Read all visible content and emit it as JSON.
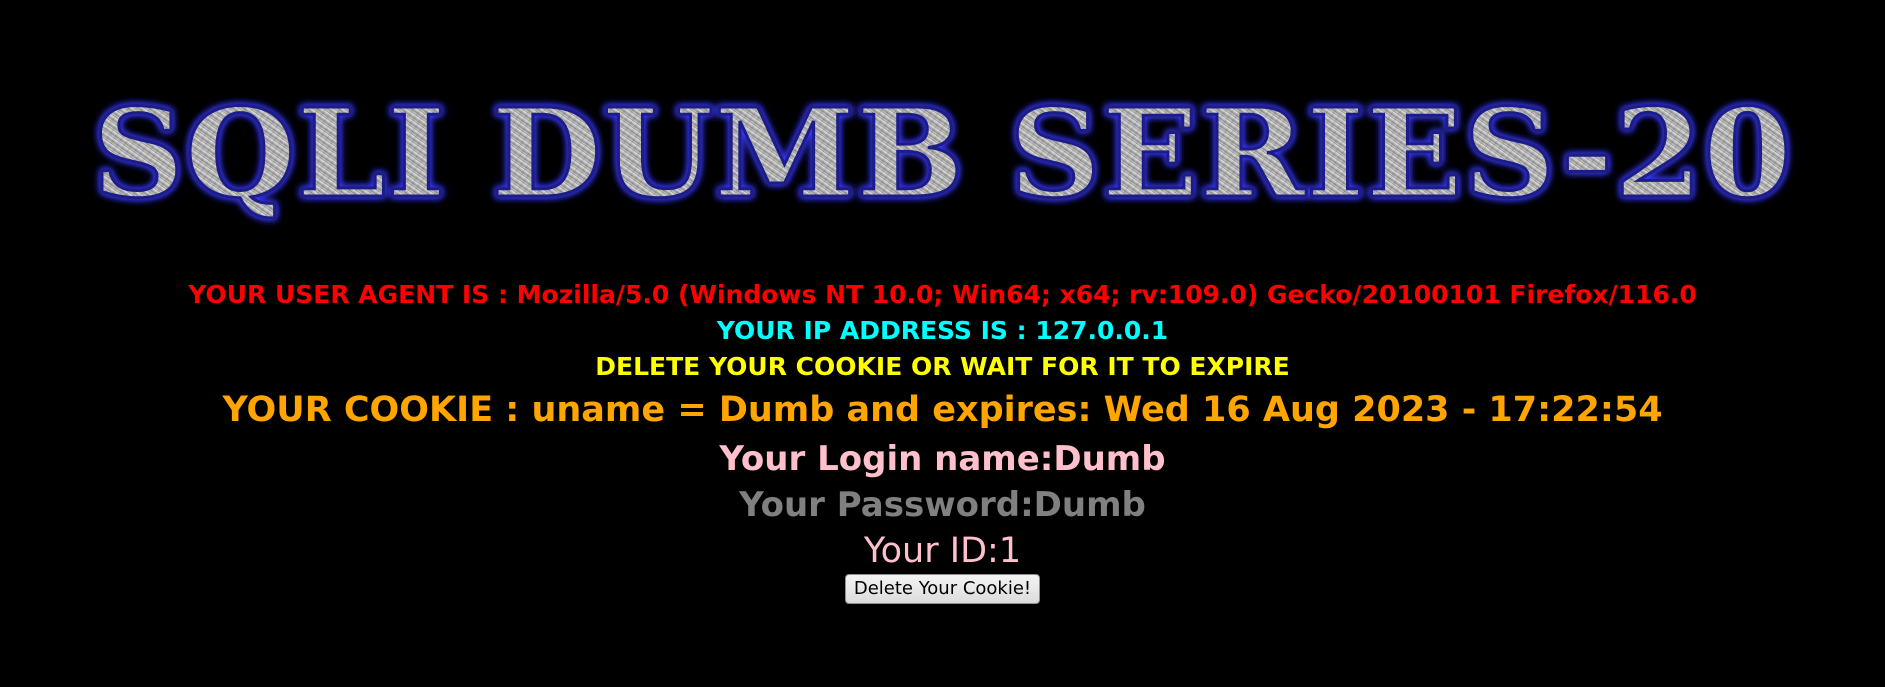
{
  "banner": {
    "title": "SQLI DUMB SERIES-20"
  },
  "info": {
    "user_agent": "YOUR USER AGENT IS : Mozilla/5.0 (Windows NT 10.0; Win64; x64; rv:109.0) Gecko/20100101 Firefox/116.0",
    "ip_address": "YOUR IP ADDRESS IS : 127.0.0.1",
    "delete_message": "DELETE YOUR COOKIE OR WAIT FOR IT TO EXPIRE",
    "cookie": "YOUR COOKIE : uname = Dumb and expires: Wed 16 Aug 2023 - 17:22:54",
    "login_name": "Your Login name:Dumb",
    "password": "Your Password:Dumb",
    "id": "Your ID:1"
  },
  "actions": {
    "delete_cookie_label": "Delete Your Cookie!"
  },
  "colors": {
    "background": "#000000",
    "user_agent": "#ff0000",
    "ip_address": "#00ffff",
    "delete_message": "#ffff00",
    "cookie": "#ffa500",
    "login_name": "#ffc0cb",
    "password": "#808080",
    "id": "#ffc0cb"
  }
}
